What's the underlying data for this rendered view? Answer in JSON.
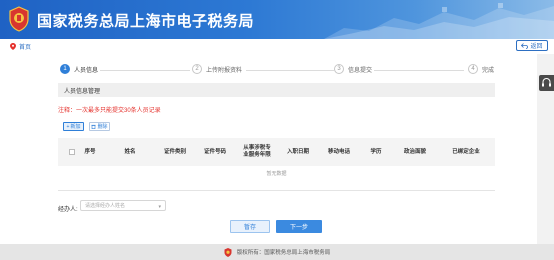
{
  "header": {
    "title": "国家税务总局上海市电子税务局"
  },
  "breadcrumb": {
    "home_label": "首页",
    "back_label": "返回"
  },
  "steps": [
    {
      "num": "1",
      "label": "人员信息",
      "state": "active"
    },
    {
      "num": "2",
      "label": "上传附报资料",
      "state": "todo"
    },
    {
      "num": "3",
      "label": "信息提交",
      "state": "todo"
    },
    {
      "num": "4",
      "label": "完成",
      "state": "todo"
    }
  ],
  "section": {
    "title": "人员信息管理",
    "note": "注释：一次最多只能提交30条人员记录"
  },
  "toolbar": {
    "add_label": "新加",
    "delete_label": "删除"
  },
  "table": {
    "columns": [
      "序号",
      "姓名",
      "证件类别",
      "证件号码",
      "从事涉税专业服务年限",
      "入职日期",
      "移动电话",
      "学历",
      "政治面貌",
      "已绑定企业"
    ],
    "empty_text": "暂无数据"
  },
  "form": {
    "handler_label": "经办人:",
    "handler_placeholder": "请选择经办人姓名"
  },
  "actions": {
    "save_label": "暂存",
    "next_label": "下一步"
  },
  "footer": {
    "text": "版权所有：国家税务总局上海市税务局"
  },
  "colors": {
    "brand": "#2d79d4",
    "accent": "#2f7fd8",
    "warning": "#e5322d"
  }
}
